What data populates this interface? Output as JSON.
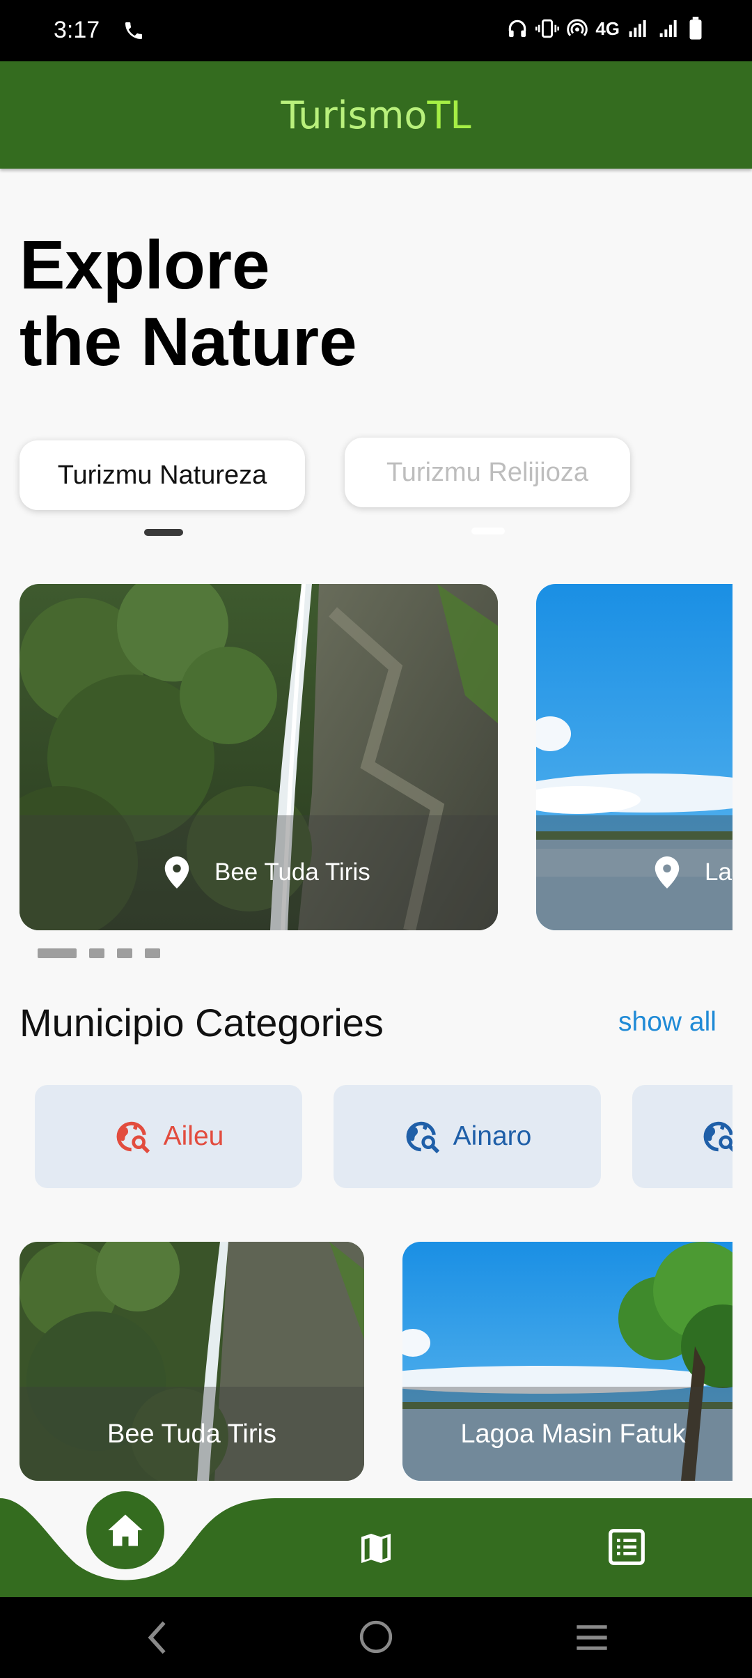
{
  "status_bar": {
    "time": "3:17",
    "network": "4G"
  },
  "app_bar": {
    "title_part1": "Turismo",
    "title_part2": "TL"
  },
  "hero": {
    "line1": "Explore",
    "line2": "the Nature"
  },
  "tabs": [
    {
      "label": "Turizmu Natureza",
      "selected": true
    },
    {
      "label": "Turizmu Relijioza",
      "selected": false
    }
  ],
  "carousel": {
    "cards": [
      {
        "label": "Bee Tuda Tiris"
      },
      {
        "label": "La"
      }
    ],
    "page_count": 4,
    "active_page": 1
  },
  "categories": {
    "title": "Municipio Categories",
    "show_all": "show all",
    "items": [
      {
        "label": "Aileu",
        "color": "#e24c3e"
      },
      {
        "label": "Ainaro",
        "color": "#1f5fa8"
      },
      {
        "label": "",
        "color": "#1f5fa8"
      }
    ]
  },
  "tiles": [
    {
      "label": "Bee Tuda Tiris"
    },
    {
      "label": "Lagoa Masin Fatuk"
    }
  ],
  "bottom_nav": {
    "items": [
      {
        "icon": "home-icon",
        "active": true
      },
      {
        "icon": "map-icon",
        "active": false
      },
      {
        "icon": "list-icon",
        "active": false
      }
    ],
    "color": "#346c1f"
  }
}
